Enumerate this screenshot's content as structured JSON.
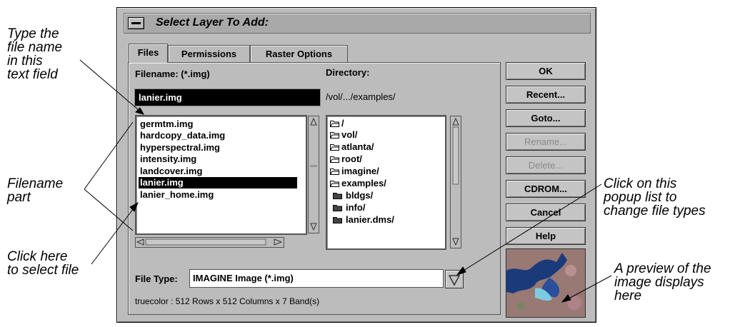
{
  "callouts": {
    "type_name": "Type the\nfile name\nin this\ntext field",
    "filename_part": "Filename\npart",
    "click_select": "Click here\nto select file",
    "popup_list": "Click on this\npopup list to\nchange file types",
    "preview": "A preview of the\nimage displays\nhere"
  },
  "dialog": {
    "title": "Select Layer To Add:",
    "tabs": [
      "Files",
      "Permissions",
      "Raster Options"
    ],
    "filename_label": "Filename: (*.img)",
    "filename_value": "lanier.img",
    "directory_label": "Directory:",
    "directory_value": "/vol/.../examples/",
    "files": [
      "germtm.img",
      "hardcopy_data.img",
      "hyperspectral.img",
      "intensity.img",
      "landcover.img",
      "lanier.img",
      "lanier_home.img"
    ],
    "selected_file": "lanier.img",
    "directories": [
      "/",
      "vol/",
      "atlanta/",
      "root/",
      "imagine/",
      "examples/",
      "bldgs/",
      "info/",
      "lanier.dms/"
    ],
    "file_type_label": "File Type:",
    "file_type_value": "IMAGINE Image (*.img)",
    "status": "truecolor : 512 Rows x 512 Columns x 7 Band(s)",
    "buttons": {
      "ok": "OK",
      "recent": "Recent...",
      "goto": "Goto...",
      "rename": "Rename...",
      "delete": "Delete...",
      "cdrom": "CDROM...",
      "cancel": "Cancel",
      "help": "Help"
    }
  },
  "colors": {
    "dialog_bg": "#bcbcbc",
    "preview_water": "#1b3a7a",
    "preview_land": "#a8707a"
  }
}
